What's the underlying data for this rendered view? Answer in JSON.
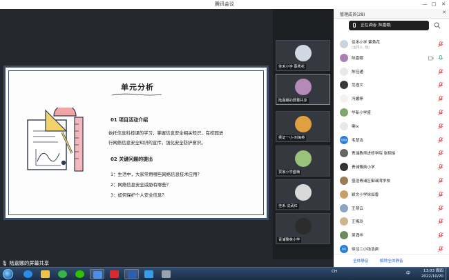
{
  "window": {
    "title": "腾讯会议",
    "controls": [
      "—",
      "□",
      "✕"
    ]
  },
  "share": {
    "sharer_label": "陆嘉娜的屏幕共享",
    "slide": {
      "title": "单元分析",
      "section1_heading": "01  项目活动介绍",
      "section1_body": [
        "依托信息科技课的学习，掌握信息安全相关知识，在校园进",
        "行网络信息安全知识的宣传，强化安全防护意识。"
      ],
      "section2_heading": "02  关键问题的提出",
      "questions": [
        "1：生活中，大家常用哪些网络信息技术应用？",
        "2：网络信息安全威胁有哪些？",
        "3：如何保护个人安全信息？"
      ]
    }
  },
  "video_tiles": [
    {
      "name": "佳禾小学 蔡秀花",
      "avatar_color": "#cfd8e3",
      "active": false
    },
    {
      "name": "陆嘉娜的屏幕共享",
      "avatar_color": "#b58ab8",
      "active": true
    },
    {
      "name": "侯证一小-刘海英",
      "avatar_color": "#e0a040",
      "active": false
    },
    {
      "name": "贾家小学盛楠",
      "avatar_color": "#9ac27a",
      "active": false
    },
    {
      "name": "佳禾 沈武红",
      "avatar_color": "#d9d9d9",
      "active": false
    },
    {
      "name": "青浦豫英小学",
      "avatar_color": "#2c2c2c",
      "active": false
    }
  ],
  "panel": {
    "title": "管理成员(28)",
    "speaking": "正在讲话: 陆嘉娜;",
    "members": [
      {
        "name": "佳禾小学 蔡秀花",
        "sub": "(主持人, 我)",
        "avatar": "#c9d3df",
        "mic": "muted",
        "cam": false
      },
      {
        "name": "陆嘉娜",
        "sub": "",
        "avatar": "#a77fb0",
        "mic": "on",
        "cam": true
      },
      {
        "name": "陈佳通",
        "sub": "",
        "avatar": "#e8e8e8",
        "mic": "muted",
        "cam": false
      },
      {
        "name": "范逸文",
        "sub": "",
        "avatar": "#3a3a3a",
        "mic": "muted",
        "cam": false
      },
      {
        "name": "冯媛婷",
        "sub": "",
        "avatar": "#f2f2f2",
        "mic": "muted",
        "cam": false
      },
      {
        "name": "华新小学盛",
        "sub": "",
        "avatar": "#7ea86a",
        "mic": "muted",
        "cam": false
      },
      {
        "name": "喇lx",
        "sub": "",
        "avatar": "#e8e8e8",
        "mic": "muted",
        "cam": false
      },
      {
        "name": "毛慧洁",
        "sub": "",
        "avatar": "#2b7fd6",
        "mic": "muted",
        "cam": false,
        "avatar_text": "毛慧洁"
      },
      {
        "name": "青浦教师进修学院 张栩焰",
        "sub": "",
        "avatar": "#666666",
        "mic": "muted",
        "cam": false
      },
      {
        "name": "青浦豫英小学",
        "sub": "",
        "avatar": "#333333",
        "mic": "muted",
        "cam": false
      },
      {
        "name": "盛浩青浦区御澜湾学校",
        "sub": "",
        "avatar": "#9c7b55",
        "mic": "muted",
        "cam": false
      },
      {
        "name": "颖文小学徐如香",
        "sub": "",
        "avatar": "#c89e6a",
        "mic": "muted",
        "cam": false
      },
      {
        "name": "王琴云",
        "sub": "",
        "avatar": "#8aa4c2",
        "mic": "muted",
        "cam": false
      },
      {
        "name": "王梅玲",
        "sub": "",
        "avatar": "#d2b48c",
        "mic": "muted",
        "cam": false
      },
      {
        "name": "吴涌华",
        "sub": "",
        "avatar": "#6d8c5c",
        "mic": "muted",
        "cam": false
      },
      {
        "name": "徐泾二小钱浩英",
        "sub": "",
        "avatar": "#2b7fd6",
        "mic": "muted",
        "cam": false,
        "avatar_text": "徐英"
      }
    ],
    "footer": {
      "mute_all": "全体静音",
      "unmute_all": "解除全体静音"
    }
  },
  "taskbar": {
    "apps": [
      {
        "name": "ie-icon",
        "color": "#2b8be6",
        "running": false
      },
      {
        "name": "folder-icon",
        "color": "#f1c24b",
        "running": false
      },
      {
        "name": "360-icon",
        "color": "#37b34a",
        "running": false
      },
      {
        "name": "wechat-icon",
        "color": "#2dc100",
        "running": false
      },
      {
        "name": "tencent-meeting-icon",
        "color": "#4a8ff0",
        "running": true
      },
      {
        "name": "pdf-icon",
        "color": "#d92b2b",
        "running": false
      },
      {
        "name": "word-icon",
        "color": "#2b5eb8",
        "running": true
      },
      {
        "name": "cloud-icon",
        "color": "#3a9ce8",
        "running": false
      },
      {
        "name": "browser-icon",
        "color": "#9aa3ad",
        "running": false
      }
    ],
    "ime": "中",
    "lang": "CH",
    "time": "13:03 周四",
    "date": "2022/10/20"
  }
}
